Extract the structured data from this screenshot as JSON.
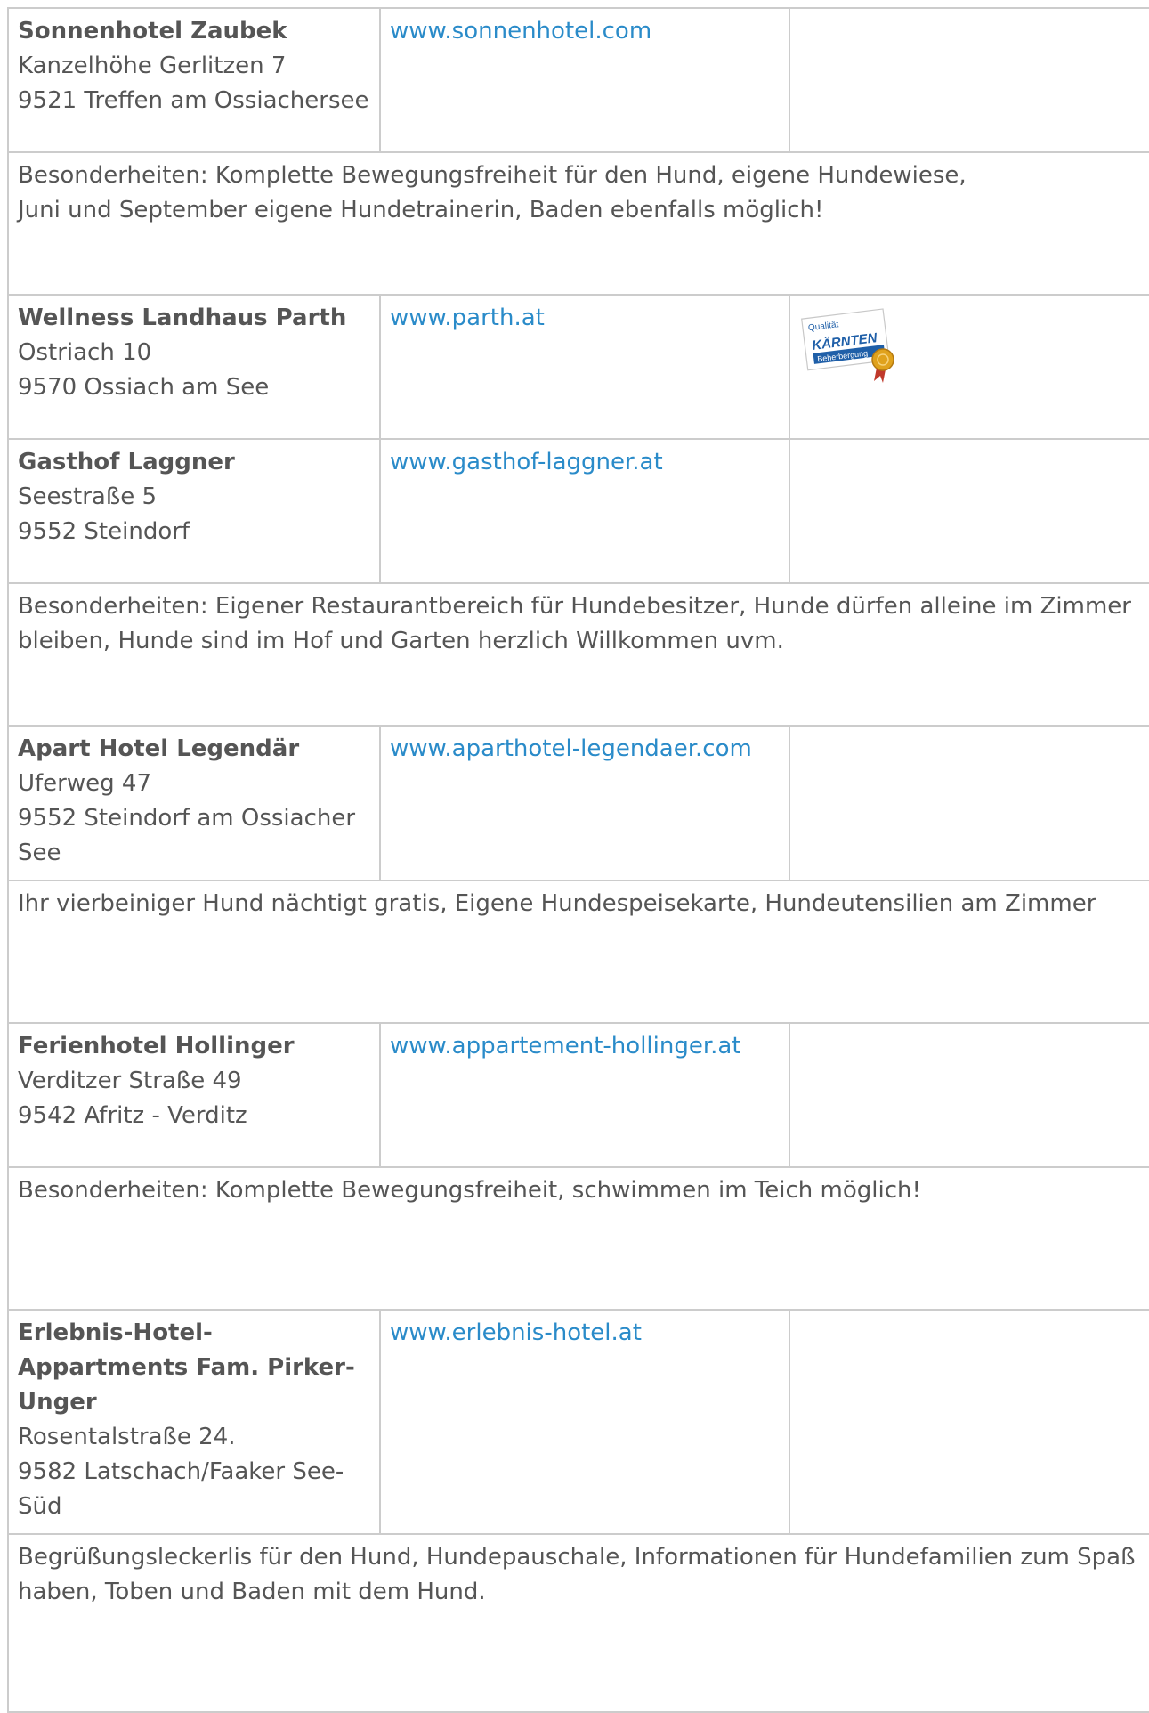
{
  "hotels": [
    {
      "name": "Sonnenhotel Zaubek",
      "address": [
        "Kanzelhöhe Gerlitzen 7",
        "9521 Treffen am Ossiachersee"
      ],
      "url": "www.sonnenhotel.com",
      "badge": null,
      "note": "Besonderheiten: Komplette Bewegungsfreiheit für den Hund, eigene Hundewiese,\nJuni und September eigene Hundetrainerin,  Baden ebenfalls möglich!"
    },
    {
      "name": "Wellness Landhaus Parth",
      "address": [
        "Ostriach 10",
        "9570 Ossiach am See"
      ],
      "url": "www.parth.at",
      "badge": {
        "top": "Qualität",
        "main": "KÄRNTEN",
        "bottom": "Beherbergung"
      },
      "note": null
    },
    {
      "name": "Gasthof Laggner",
      "address": [
        "Seestraße 5",
        "9552 Steindorf"
      ],
      "url": "www.gasthof-laggner.at",
      "badge": null,
      "note": "Besonderheiten: Eigener Restaurantbereich für Hundebesitzer, Hunde dürfen alleine im Zimmer bleiben, Hunde sind im Hof und Garten herzlich Willkommen uvm."
    },
    {
      "name": "Apart Hotel Legendär",
      "address": [
        "Uferweg 47",
        "9552 Steindorf am Ossiacher See"
      ],
      "url": "www.aparthotel-legendaer.com",
      "badge": null,
      "note": "Ihr vierbeiniger Hund nächtigt gratis, Eigene Hundespeisekarte, Hundeutensilien am Zimmer"
    },
    {
      "name": "Ferienhotel Hollinger",
      "address": [
        "Verditzer Straße 49",
        "9542 Afritz - Verditz"
      ],
      "url": "www.appartement-hollinger.at",
      "badge": null,
      "note": "Besonderheiten: Komplette Bewegungsfreiheit, schwimmen im Teich möglich!"
    },
    {
      "name": "Erlebnis-Hotel-Appartments Fam. Pirker-Unger",
      "address": [
        "Rosentalstraße 24.",
        "9582 Latschach/Faaker See-Süd"
      ],
      "url": "www.erlebnis-hotel.at",
      "badge": null,
      "note": "Begrüßungsleckerlis für den Hund, Hundepauschale, Informationen für Hundefamilien zum Spaß haben, Toben und Baden mit dem Hund."
    }
  ],
  "colors": {
    "link": "#2a8bc9",
    "text": "#555555",
    "border": "#cccccc",
    "badge_blue": "#1f5fa8",
    "badge_gold": "#e0a21c"
  }
}
